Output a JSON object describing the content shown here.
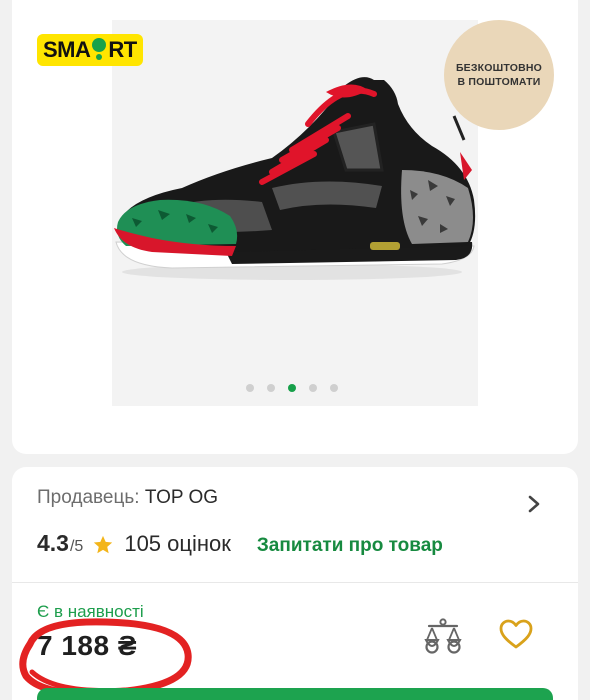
{
  "gallery": {
    "logo_text": "SMA!RT",
    "logo_left": "SMA",
    "logo_right": "RT",
    "promo_line1": "БЕЗКОШТОВНО",
    "promo_line2": "В ПОШТОМАТИ",
    "slides_count": 5,
    "active_slide": 3
  },
  "seller": {
    "label": "Продавець:",
    "name": "TOP OG"
  },
  "rating": {
    "value": "4.3",
    "max": "/5",
    "reviews": "105 оцінок",
    "ask_link": "Запитати про товар"
  },
  "offer": {
    "stock_status": "Є в наявності",
    "price": "7 188 ₴"
  },
  "colors": {
    "brand_green": "#1da34f",
    "smart_yellow": "#ffe500",
    "favorite_gold": "#d9a21b",
    "annotation_red": "#e32222"
  },
  "icons": {
    "compare": "scales-icon",
    "favorite": "heart-icon",
    "rating": "star-icon",
    "next": "chevron-right-icon"
  }
}
